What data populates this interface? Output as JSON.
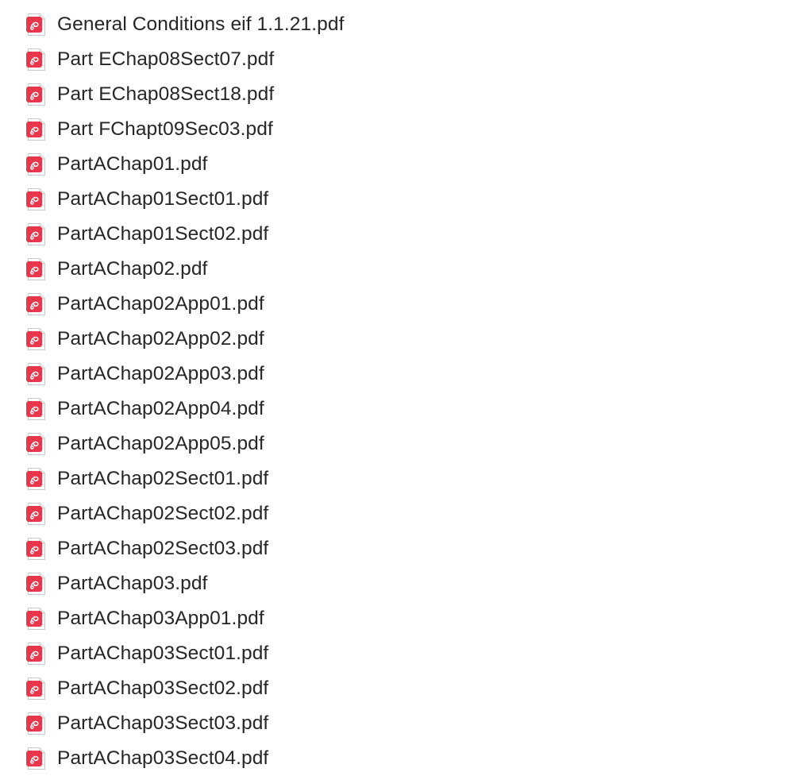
{
  "file_icon": "pdf-document-icon",
  "accent_color": "#e8364a",
  "files": [
    {
      "name": "General Conditions eif 1.1.21.pdf"
    },
    {
      "name": "Part EChap08Sect07.pdf"
    },
    {
      "name": "Part EChap08Sect18.pdf"
    },
    {
      "name": "Part FChapt09Sec03.pdf"
    },
    {
      "name": "PartAChap01.pdf"
    },
    {
      "name": "PartAChap01Sect01.pdf"
    },
    {
      "name": "PartAChap01Sect02.pdf"
    },
    {
      "name": "PartAChap02.pdf"
    },
    {
      "name": "PartAChap02App01.pdf"
    },
    {
      "name": "PartAChap02App02.pdf"
    },
    {
      "name": "PartAChap02App03.pdf"
    },
    {
      "name": "PartAChap02App04.pdf"
    },
    {
      "name": "PartAChap02App05.pdf"
    },
    {
      "name": "PartAChap02Sect01.pdf"
    },
    {
      "name": "PartAChap02Sect02.pdf"
    },
    {
      "name": "PartAChap02Sect03.pdf"
    },
    {
      "name": "PartAChap03.pdf"
    },
    {
      "name": "PartAChap03App01.pdf"
    },
    {
      "name": "PartAChap03Sect01.pdf"
    },
    {
      "name": "PartAChap03Sect02.pdf"
    },
    {
      "name": "PartAChap03Sect03.pdf"
    },
    {
      "name": "PartAChap03Sect04.pdf"
    }
  ]
}
